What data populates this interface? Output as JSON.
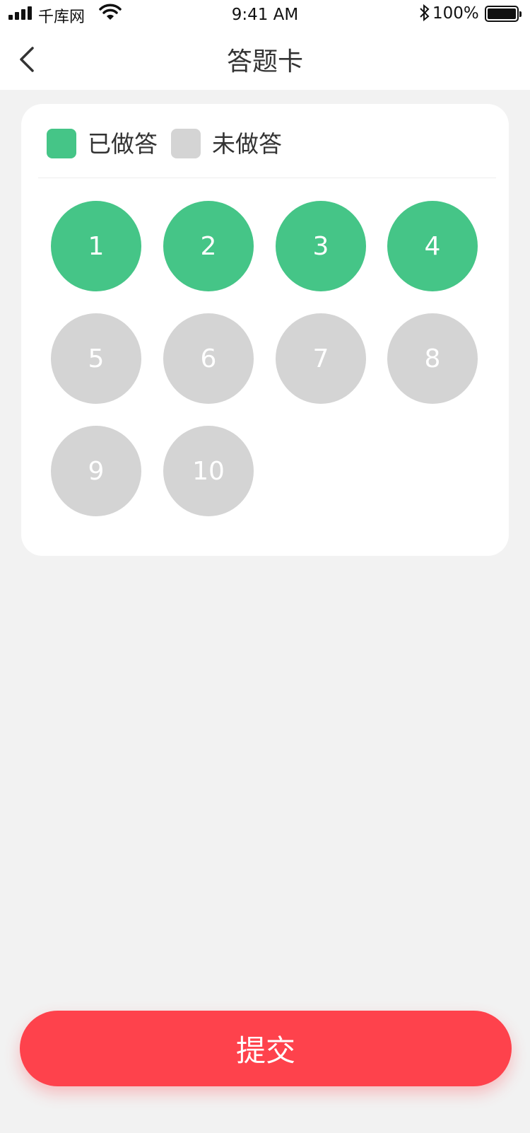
{
  "status_bar": {
    "carrier": "千库网",
    "time": "9:41 AM",
    "battery": "100%",
    "icons": [
      "signal-icon",
      "wifi-icon",
      "bluetooth-icon",
      "battery-icon"
    ]
  },
  "nav": {
    "title": "答题卡",
    "back_icon": "chevron-left-icon"
  },
  "legend": [
    {
      "label": "已做答",
      "color": "#45c587"
    },
    {
      "label": "未做答",
      "color": "#d4d4d4"
    }
  ],
  "questions": [
    {
      "label": "1",
      "answered": true
    },
    {
      "label": "2",
      "answered": true
    },
    {
      "label": "3",
      "answered": true
    },
    {
      "label": "4",
      "answered": true
    },
    {
      "label": "5",
      "answered": false
    },
    {
      "label": "6",
      "answered": false
    },
    {
      "label": "7",
      "answered": false
    },
    {
      "label": "8",
      "answered": false
    },
    {
      "label": "9",
      "answered": false
    },
    {
      "label": "10",
      "answered": false
    }
  ],
  "colors": {
    "answered": "#45c587",
    "unanswered": "#d4d4d4",
    "submit": "#fe424c"
  },
  "submit_label": "提交"
}
